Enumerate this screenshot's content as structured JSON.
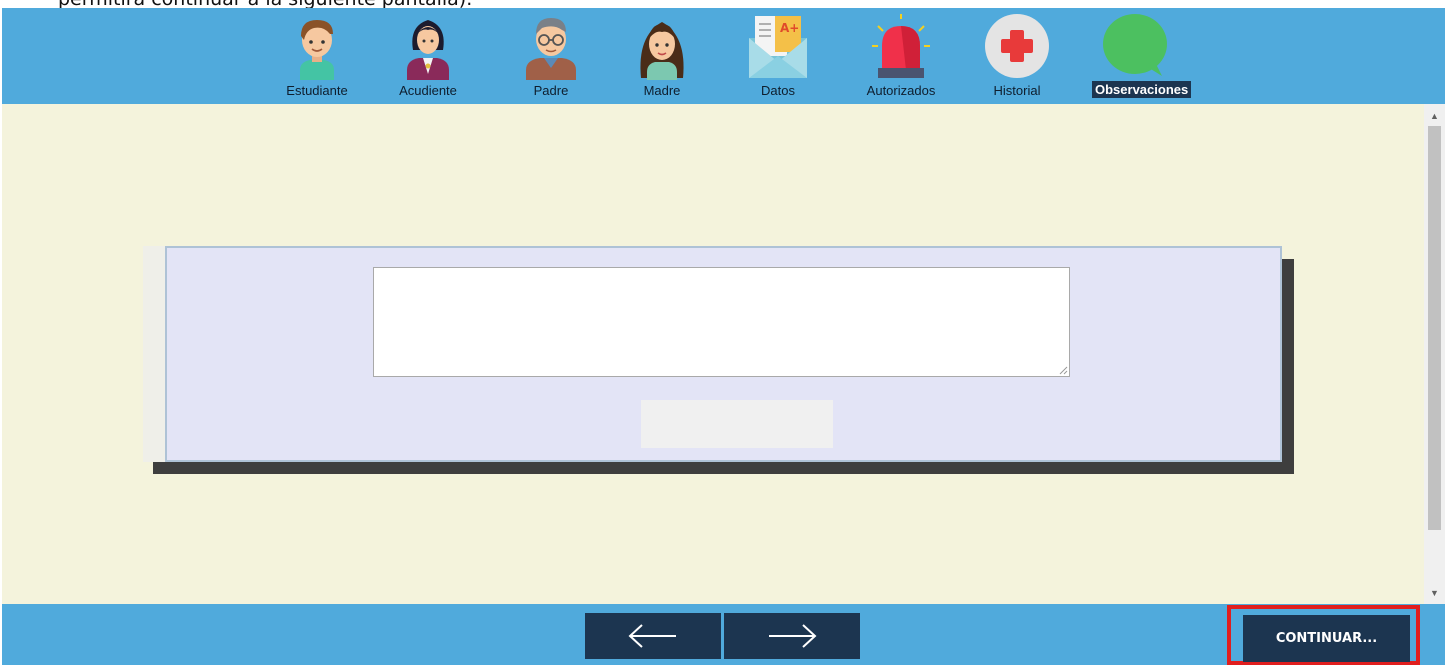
{
  "caption": "permitirá continuar a la siguiente pantalla).",
  "nav": {
    "tabs": [
      {
        "label": "Estudiante",
        "icon": "student-icon"
      },
      {
        "label": "Acudiente",
        "icon": "guardian-icon"
      },
      {
        "label": "Padre",
        "icon": "father-icon"
      },
      {
        "label": "Madre",
        "icon": "mother-icon"
      },
      {
        "label": "Datos",
        "icon": "data-envelope-icon"
      },
      {
        "label": "Autorizados",
        "icon": "alarm-siren-icon"
      },
      {
        "label": "Historial",
        "icon": "medical-cross-icon"
      },
      {
        "label": "Observaciones",
        "icon": "speech-bubble-icon",
        "active": true
      }
    ]
  },
  "observations": {
    "value": "",
    "save_label": ""
  },
  "footer": {
    "prev_icon": "arrow-left-icon",
    "next_icon": "arrow-right-icon",
    "continue_label": "CONTINUAR..."
  },
  "colors": {
    "header_bg": "#50aadc",
    "content_bg": "#f4f3dc",
    "panel_bg": "#e3e4f6",
    "button_bg": "#1c3550",
    "highlight": "#e01e1e"
  }
}
